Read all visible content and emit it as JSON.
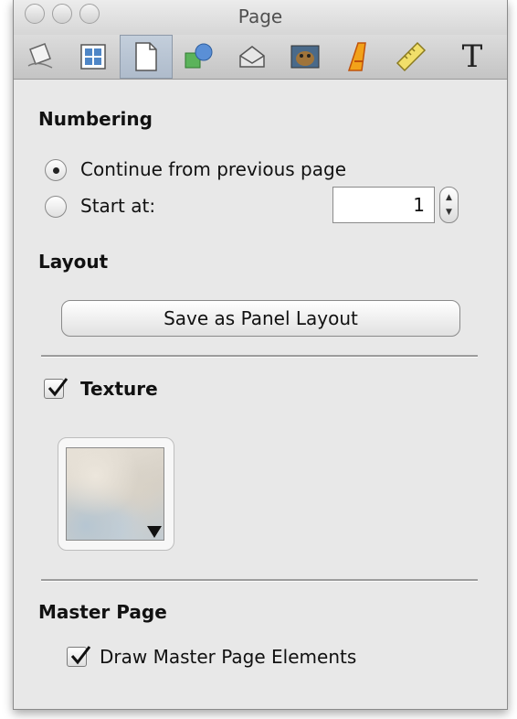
{
  "window": {
    "title": "Page"
  },
  "toolbar": {
    "tools": [
      {
        "icon": "document-inspector-icon"
      },
      {
        "icon": "layout-grid-icon"
      },
      {
        "icon": "page-icon"
      },
      {
        "icon": "shapes-icon"
      },
      {
        "icon": "stroke-fill-icon"
      },
      {
        "icon": "image-icon"
      },
      {
        "icon": "text-style-icon"
      },
      {
        "icon": "ruler-icon"
      },
      {
        "icon": "text-icon",
        "glyph": "T"
      }
    ],
    "selected_index": 2
  },
  "numbering": {
    "heading": "Numbering",
    "continue_label": "Continue from previous page",
    "start_label": "Start at:",
    "start_value": "1",
    "selected": "continue"
  },
  "layout": {
    "heading": "Layout",
    "save_button": "Save as Panel Layout"
  },
  "texture": {
    "label": "Texture",
    "checked": true
  },
  "master_page": {
    "heading": "Master Page",
    "draw_label": "Draw Master Page Elements",
    "checked": true
  }
}
